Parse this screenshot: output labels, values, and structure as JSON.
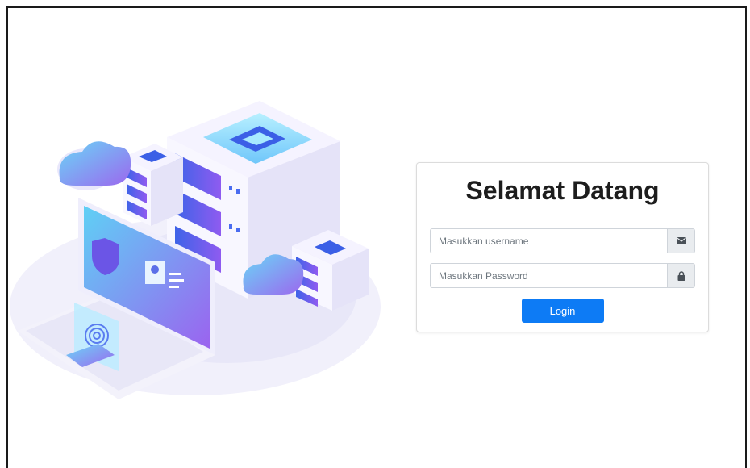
{
  "login": {
    "title": "Selamat Datang",
    "username": {
      "value": "",
      "placeholder": "Masukkan username",
      "icon": "envelope-icon"
    },
    "password": {
      "value": "",
      "placeholder": "Masukkan Password",
      "icon": "lock-icon"
    },
    "submit_label": "Login"
  },
  "colors": {
    "primary_button": "#0d7bf5",
    "addon_bg": "#e9ecef",
    "illustration_accent": "#5a7cf0",
    "illustration_secondary": "#a46ef0"
  }
}
